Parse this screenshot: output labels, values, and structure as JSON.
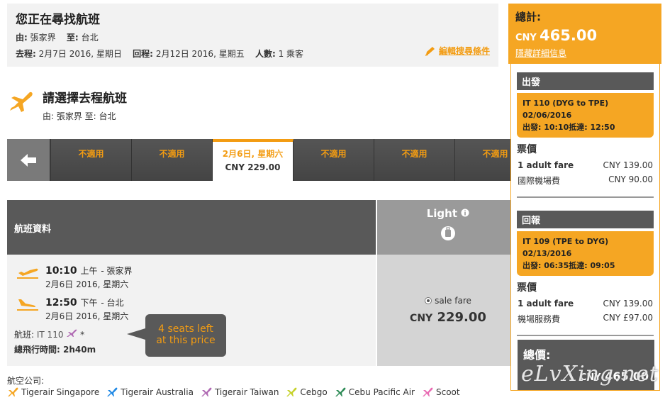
{
  "search": {
    "title": "您正在尋找航班",
    "from_label": "由:",
    "from": "張家界",
    "to_label": "至:",
    "to": "台北",
    "depart_label": "去程:",
    "depart_date": "2月7日 2016, 星期日",
    "return_label": "回程:",
    "return_date": "2月12日 2016, 星期五",
    "pax_label": "人數:",
    "pax": "1 乘客",
    "edit_label": "編輯搜尋條件"
  },
  "choose": {
    "title": "請選擇去程航班",
    "route": "由: 張家界 至: 台北"
  },
  "carousel": {
    "cells": [
      {
        "date": "不適用",
        "price": ""
      },
      {
        "date": "不適用",
        "price": ""
      },
      {
        "date": "2月6日, 星期六",
        "price": "CNY 229.00",
        "active": true
      },
      {
        "date": "不適用",
        "price": ""
      },
      {
        "date": "不適用",
        "price": ""
      },
      {
        "date": "不適用",
        "price": ""
      }
    ]
  },
  "flight": {
    "header": "航班資料",
    "dep_time": "10:10",
    "dep_ampm": "上午",
    "dep_city": "- 張家界",
    "dep_date": "2月6日 2016, 星期六",
    "arr_time": "12:50",
    "arr_ampm": "下午",
    "arr_city": "- 台北",
    "arr_date": "2月6日 2016, 星期六",
    "flight_label": "航班:",
    "flight_no": "IT 110",
    "flight_star": "*",
    "duration_label": "總飛行時間:",
    "duration": "2h40m",
    "seats_note_line1": "4 seats left",
    "seats_note_line2": "at this price"
  },
  "light": {
    "title": "Light",
    "sale_label": "sale fare",
    "price_cur": "CNY",
    "price": "229.00"
  },
  "airlines": {
    "label": "航空公司:",
    "items": [
      {
        "name": "Tigerair Singapore",
        "color": "#f5a623"
      },
      {
        "name": "Tigerair Australia",
        "color": "#1e88e5"
      },
      {
        "name": "Tigerair Taiwan",
        "color": "#b06ab3"
      },
      {
        "name": "Cebgo",
        "color": "#c6d22a"
      },
      {
        "name": "Cebu Pacific Air",
        "color": "#2e8b57"
      },
      {
        "name": "Scoot",
        "color": "#e96bb3"
      }
    ]
  },
  "summary": {
    "total_label": "總計:",
    "total_cur": "CNY",
    "total_amount": "465.00",
    "hide_label": "隱藏詳細信息",
    "depart_head": "出發",
    "depart_seg": {
      "line1": "IT 110 (DYG to TPE)",
      "line2": "02/06/2016",
      "line3": "出發: 10:10抵達: 12:50"
    },
    "depart_fare_title": "票價",
    "depart_fares": [
      {
        "label": "1 adult fare",
        "value": "CNY 139.00"
      },
      {
        "label": "國際機場費",
        "value": "CNY 90.00"
      }
    ],
    "return_head": "回報",
    "return_seg": {
      "line1": "IT 109 (TPE to DYG)",
      "line2": "02/13/2016",
      "line3": "出發: 06:35抵達: 09:05"
    },
    "return_fare_title": "票價",
    "return_fares": [
      {
        "label": "1 adult fare",
        "value": "CNY 139.00"
      },
      {
        "label": "機場服務費",
        "value": "CNY £97.00"
      }
    ],
    "grand_label": "總價:",
    "grand_cur": "CNY",
    "grand_amount": "465.00"
  },
  "watermark": "eLvXing.net",
  "colors": {
    "accent": "#f5a623",
    "dark": "#595959"
  }
}
